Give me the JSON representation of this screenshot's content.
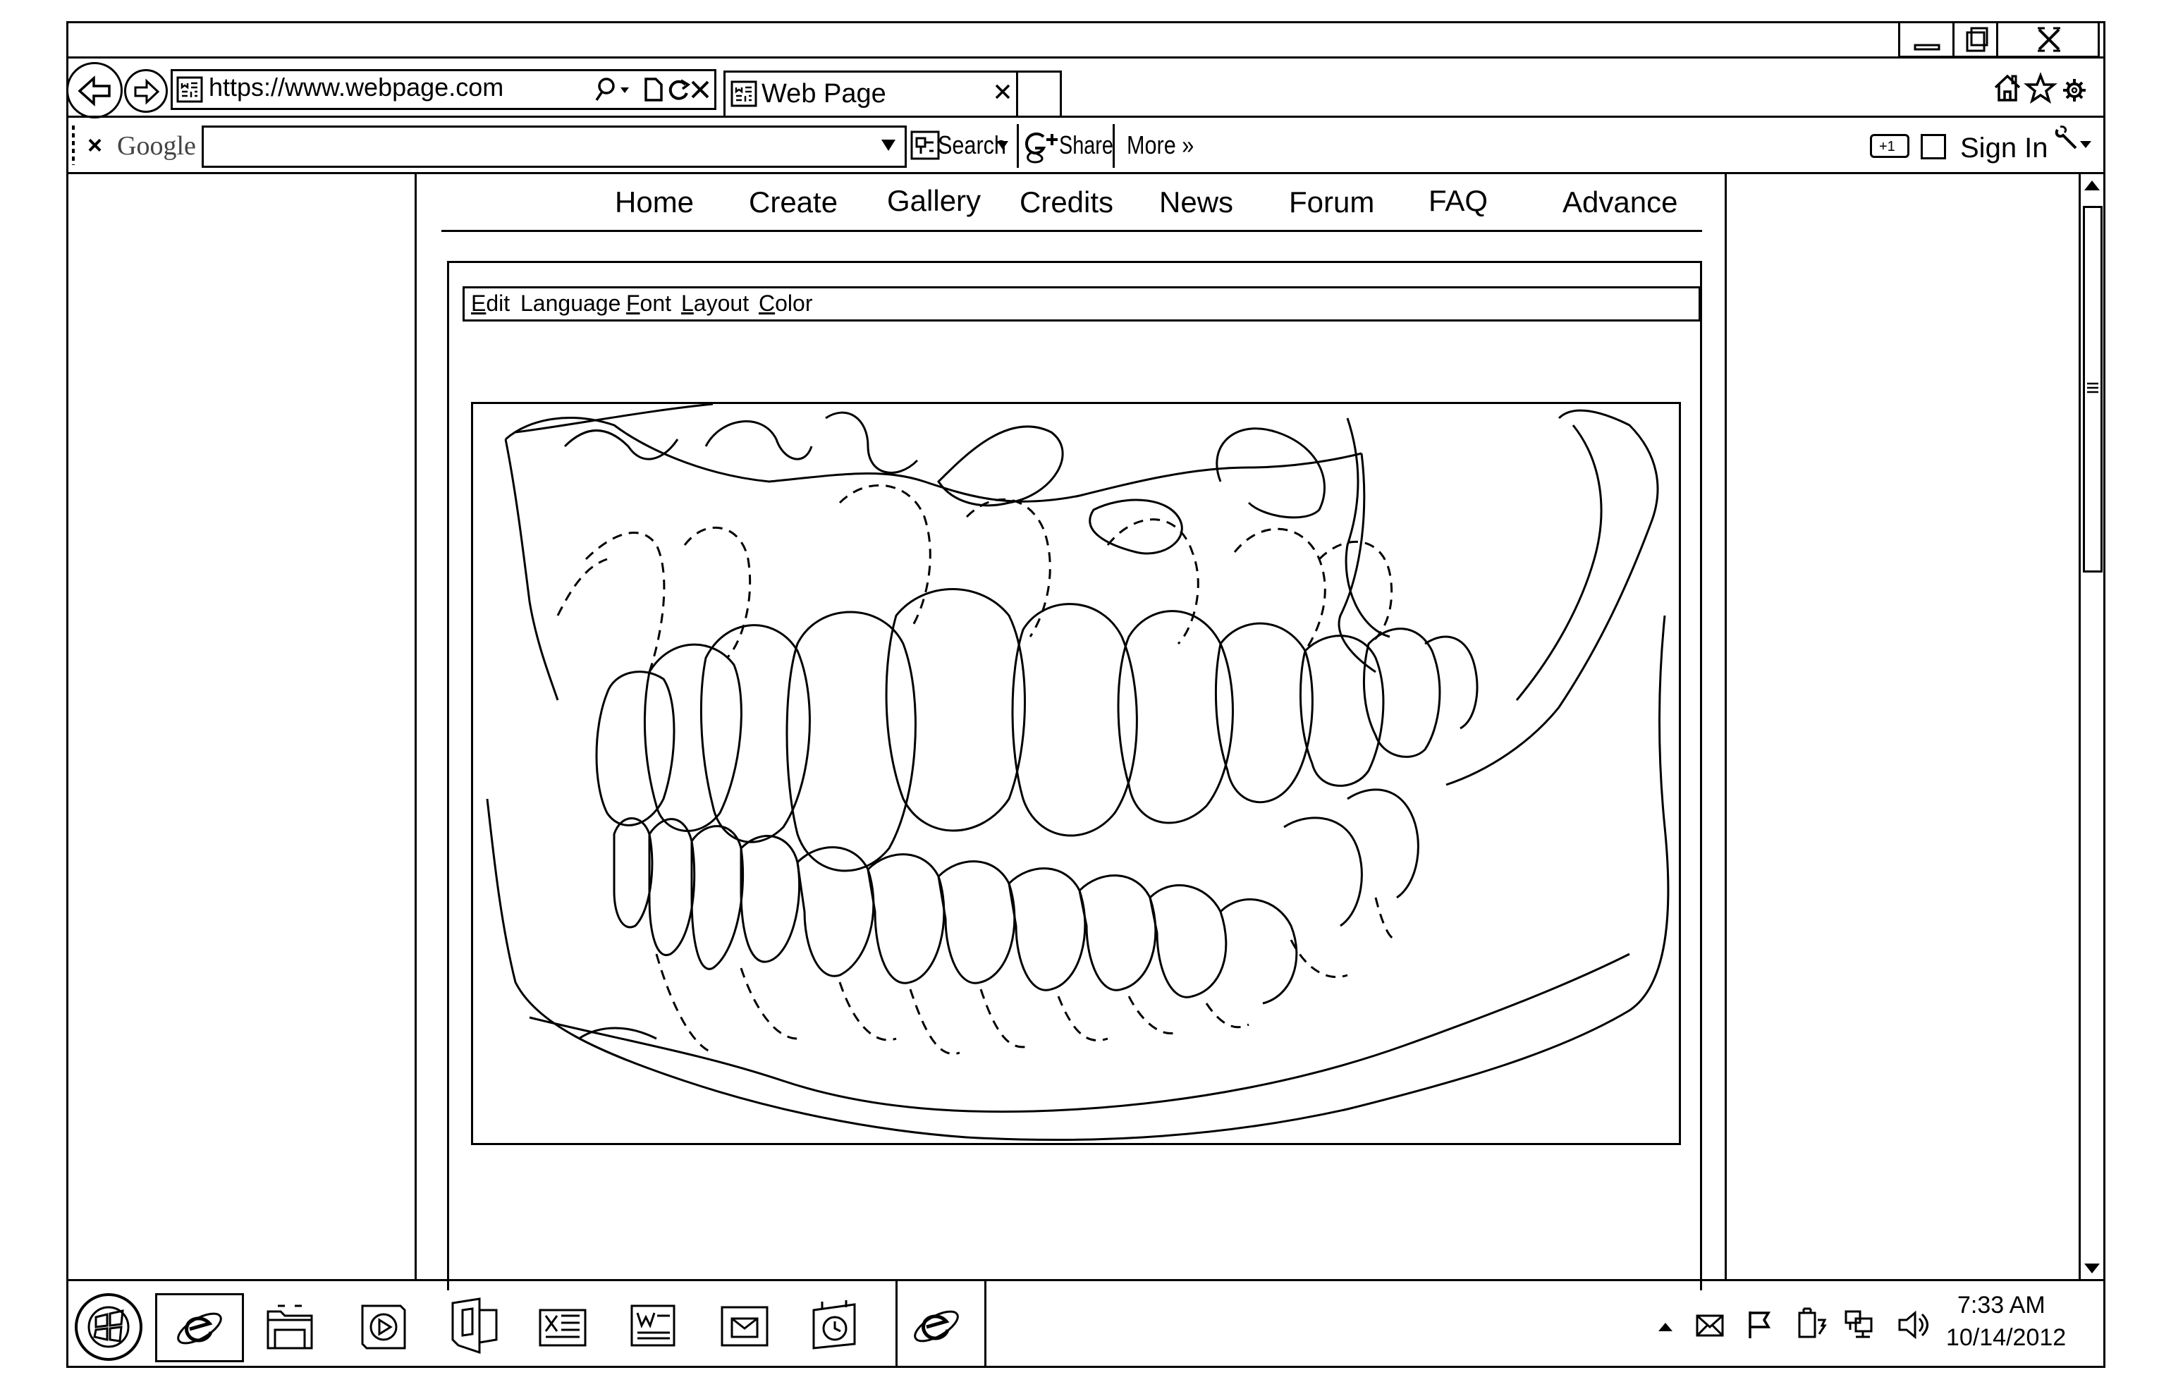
{
  "window": {
    "minimize_icon": "minimize-icon",
    "restore_icon": "restore-icon",
    "close_icon": "close-icon"
  },
  "addressbar": {
    "url": "https://www.webpage.com",
    "site_icon": "webpage-favicon-icon",
    "search_icon": "search-icon"
  },
  "tab": {
    "title": "Web Page",
    "favicon": "webpage-favicon-icon"
  },
  "browser_icons": {
    "home": "home-icon",
    "favorites": "star-icon",
    "settings": "gear-icon"
  },
  "toolbar": {
    "close_label": "×",
    "brand": "Google",
    "search_value": "",
    "search_label": "Search",
    "share_label": "Share",
    "more_label": "More »",
    "plus_one_label": "+1",
    "sign_in_label": "Sign In"
  },
  "nav": {
    "items": [
      "Home",
      "Create",
      "Gallery",
      "Credits",
      "News",
      "Forum",
      "FAQ",
      "Advance"
    ]
  },
  "editor_menu": {
    "items": [
      {
        "label": "Edit",
        "underline": "E"
      },
      {
        "label": "Language",
        "underline": "g"
      },
      {
        "label": "Font",
        "underline": "F"
      },
      {
        "label": "Layout",
        "underline": "L"
      },
      {
        "label": "Color",
        "underline": "C"
      }
    ]
  },
  "main_image": {
    "subject": "dental-jaw-illustration"
  },
  "taskbar": {
    "apps": [
      "start-icon",
      "internet-explorer-icon",
      "file-explorer-icon",
      "media-player-icon",
      "office-icon",
      "excel-icon",
      "word-icon",
      "outlook-icon",
      "calendar-icon",
      "internet-explorer-icon"
    ],
    "tray_icons": [
      "show-hidden-icon",
      "mail-icon",
      "flag-icon",
      "battery-icon",
      "network-icon",
      "volume-icon"
    ],
    "time": "7:33 AM",
    "date": "10/14/2012"
  }
}
